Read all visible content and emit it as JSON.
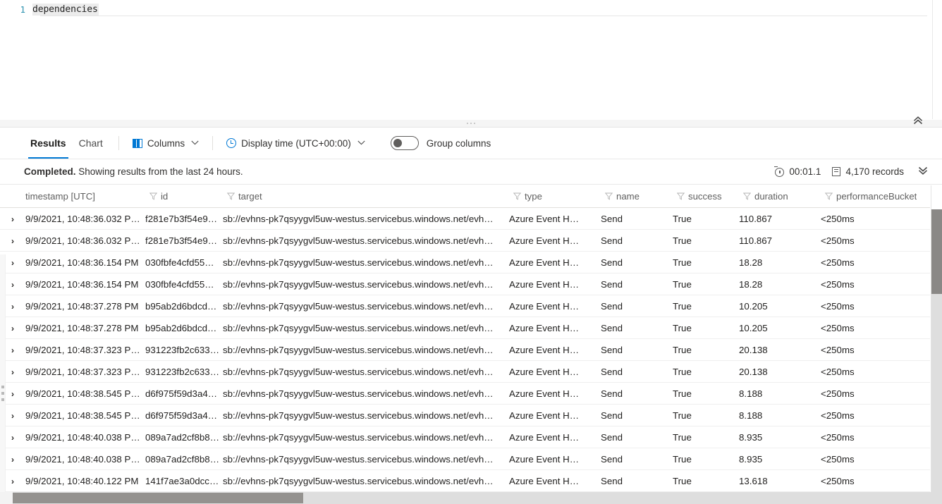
{
  "editor": {
    "lines": [
      {
        "number": "1",
        "code": "dependencies"
      }
    ]
  },
  "splitter": {
    "collapse_chevron": "«"
  },
  "toolbar": {
    "tabs": [
      {
        "label": "Results",
        "active": true
      },
      {
        "label": "Chart",
        "active": false
      }
    ],
    "columns_button": "Columns",
    "columns_caret": "⌄",
    "display_time_button": "Display time (UTC+00:00)",
    "display_time_caret": "⌄",
    "group_columns_label": "Group columns",
    "group_columns_on": false
  },
  "status": {
    "state": "Completed.",
    "message": "Showing results from the last 24 hours.",
    "elapsed": "00:01.1",
    "records": "4,170 records",
    "expand_chevron": "ˇˇ"
  },
  "table": {
    "columns": [
      {
        "key": "timestamp",
        "label": "timestamp [UTC]",
        "filter": false
      },
      {
        "key": "id",
        "label": "id",
        "filter": true
      },
      {
        "key": "target",
        "label": "target",
        "filter": true
      },
      {
        "key": "type",
        "label": "type",
        "filter": true
      },
      {
        "key": "name",
        "label": "name",
        "filter": true
      },
      {
        "key": "success",
        "label": "success",
        "filter": true
      },
      {
        "key": "duration",
        "label": "duration",
        "filter": true
      },
      {
        "key": "performanceBucket",
        "label": "performanceBucket",
        "filter": true
      }
    ],
    "expander_glyph": "›",
    "rows": [
      {
        "timestamp": "9/9/2021, 10:48:36.032 P…",
        "id": "f281e7b3f54e9…",
        "target": "sb://evhns-pk7qsyygvl5uw-westus.servicebus.windows.net/evh…",
        "type": "Azure Event H…",
        "name": "Send",
        "success": "True",
        "duration": "110.867",
        "performanceBucket": "<250ms"
      },
      {
        "timestamp": "9/9/2021, 10:48:36.032 P…",
        "id": "f281e7b3f54e9…",
        "target": "sb://evhns-pk7qsyygvl5uw-westus.servicebus.windows.net/evh…",
        "type": "Azure Event H…",
        "name": "Send",
        "success": "True",
        "duration": "110.867",
        "performanceBucket": "<250ms"
      },
      {
        "timestamp": "9/9/2021, 10:48:36.154 PM",
        "id": "030fbfe4cfd55…",
        "target": "sb://evhns-pk7qsyygvl5uw-westus.servicebus.windows.net/evh…",
        "type": "Azure Event H…",
        "name": "Send",
        "success": "True",
        "duration": "18.28",
        "performanceBucket": "<250ms"
      },
      {
        "timestamp": "9/9/2021, 10:48:36.154 PM",
        "id": "030fbfe4cfd55…",
        "target": "sb://evhns-pk7qsyygvl5uw-westus.servicebus.windows.net/evh…",
        "type": "Azure Event H…",
        "name": "Send",
        "success": "True",
        "duration": "18.28",
        "performanceBucket": "<250ms"
      },
      {
        "timestamp": "9/9/2021, 10:48:37.278 PM",
        "id": "b95ab2d6bdcd…",
        "target": "sb://evhns-pk7qsyygvl5uw-westus.servicebus.windows.net/evh…",
        "type": "Azure Event H…",
        "name": "Send",
        "success": "True",
        "duration": "10.205",
        "performanceBucket": "<250ms"
      },
      {
        "timestamp": "9/9/2021, 10:48:37.278 PM",
        "id": "b95ab2d6bdcd…",
        "target": "sb://evhns-pk7qsyygvl5uw-westus.servicebus.windows.net/evh…",
        "type": "Azure Event H…",
        "name": "Send",
        "success": "True",
        "duration": "10.205",
        "performanceBucket": "<250ms"
      },
      {
        "timestamp": "9/9/2021, 10:48:37.323 P…",
        "id": "931223fb2c633…",
        "target": "sb://evhns-pk7qsyygvl5uw-westus.servicebus.windows.net/evh…",
        "type": "Azure Event H…",
        "name": "Send",
        "success": "True",
        "duration": "20.138",
        "performanceBucket": "<250ms"
      },
      {
        "timestamp": "9/9/2021, 10:48:37.323 P…",
        "id": "931223fb2c633…",
        "target": "sb://evhns-pk7qsyygvl5uw-westus.servicebus.windows.net/evh…",
        "type": "Azure Event H…",
        "name": "Send",
        "success": "True",
        "duration": "20.138",
        "performanceBucket": "<250ms"
      },
      {
        "timestamp": "9/9/2021, 10:48:38.545 P…",
        "id": "d6f975f59d3a4…",
        "target": "sb://evhns-pk7qsyygvl5uw-westus.servicebus.windows.net/evh…",
        "type": "Azure Event H…",
        "name": "Send",
        "success": "True",
        "duration": "8.188",
        "performanceBucket": "<250ms"
      },
      {
        "timestamp": "9/9/2021, 10:48:38.545 P…",
        "id": "d6f975f59d3a4…",
        "target": "sb://evhns-pk7qsyygvl5uw-westus.servicebus.windows.net/evh…",
        "type": "Azure Event H…",
        "name": "Send",
        "success": "True",
        "duration": "8.188",
        "performanceBucket": "<250ms"
      },
      {
        "timestamp": "9/9/2021, 10:48:40.038 P…",
        "id": "089a7ad2cf8b8…",
        "target": "sb://evhns-pk7qsyygvl5uw-westus.servicebus.windows.net/evh…",
        "type": "Azure Event H…",
        "name": "Send",
        "success": "True",
        "duration": "8.935",
        "performanceBucket": "<250ms"
      },
      {
        "timestamp": "9/9/2021, 10:48:40.038 P…",
        "id": "089a7ad2cf8b8…",
        "target": "sb://evhns-pk7qsyygvl5uw-westus.servicebus.windows.net/evh…",
        "type": "Azure Event H…",
        "name": "Send",
        "success": "True",
        "duration": "8.935",
        "performanceBucket": "<250ms"
      },
      {
        "timestamp": "9/9/2021, 10:48:40.122 PM",
        "id": "141f7ae3a0dcc1…",
        "target": "sb://evhns-pk7qsyygvl5uw-westus.servicebus.windows.net/evh…",
        "type": "Azure Event H…",
        "name": "Send",
        "success": "True",
        "duration": "13.618",
        "performanceBucket": "<250ms"
      }
    ]
  },
  "colors": {
    "accent": "#0078d4",
    "text": "#323130",
    "header_text": "#5f5f5f",
    "scrollbar_thumb": "#8a8886",
    "scrollbar_track": "#dedede"
  }
}
